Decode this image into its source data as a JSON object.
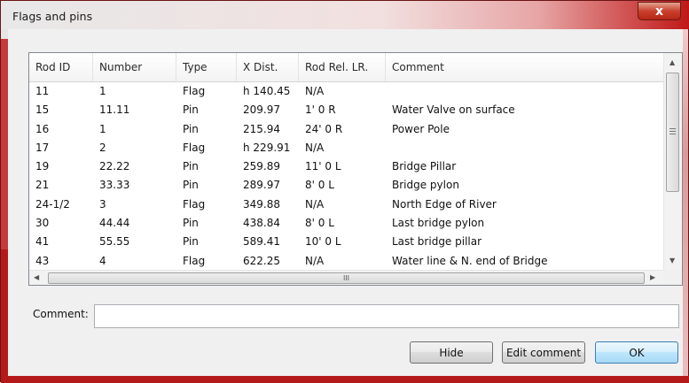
{
  "window": {
    "title": "Flags and pins",
    "close_label": "x"
  },
  "table": {
    "columns": [
      "Rod ID",
      "Number",
      "Type",
      "X Dist.",
      "Rod Rel. LR.",
      "Comment"
    ],
    "rows": [
      [
        "11",
        "1",
        "Flag",
        "h 140.45",
        "N/A",
        ""
      ],
      [
        "15",
        "11.11",
        "Pin",
        "209.97",
        "1'  0 R",
        "Water Valve on surface"
      ],
      [
        "16",
        "1",
        "Pin",
        "215.94",
        "24'  0 R",
        "Power Pole"
      ],
      [
        "17",
        "2",
        "Flag",
        "h 229.91",
        "N/A",
        ""
      ],
      [
        "19",
        "22.22",
        "Pin",
        "259.89",
        "11'  0 L",
        "Bridge Pillar"
      ],
      [
        "21",
        "33.33",
        "Pin",
        "289.97",
        "8'  0 L",
        "Bridge pylon"
      ],
      [
        "24-1/2",
        "3",
        "Flag",
        "349.88",
        "N/A",
        "North Edge of River"
      ],
      [
        "30",
        "44.44",
        "Pin",
        "438.84",
        "8'  0 L",
        "Last bridge pylon"
      ],
      [
        "41",
        "55.55",
        "Pin",
        "589.41",
        "10'  0 L",
        "Last bridge pillar"
      ],
      [
        "43",
        "4",
        "Flag",
        "622.25",
        "N/A",
        "Water line & N. end of Bridge"
      ]
    ],
    "hscroll_thumb_label": "III"
  },
  "comment": {
    "label": "Comment:",
    "value": ""
  },
  "buttons": {
    "hide": "Hide",
    "edit_comment": "Edit comment",
    "ok": "OK"
  }
}
